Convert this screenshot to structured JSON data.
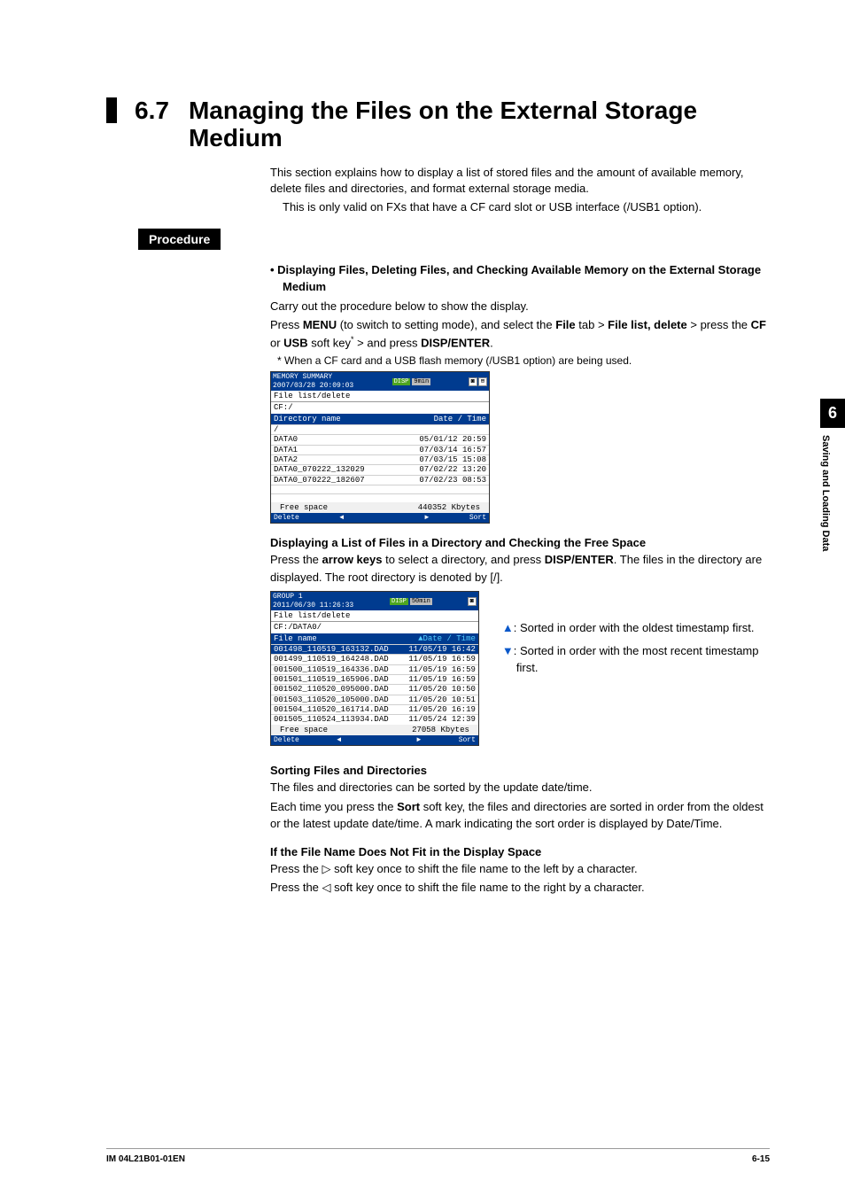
{
  "section": {
    "number": "6.7",
    "title": "Managing the Files on the External Storage Medium"
  },
  "intro": {
    "p1": "This section explains how to display a list of stored files and the amount of available memory, delete files and directories, and format external storage media.",
    "p2": "This is only valid on FXs that have a CF card slot or USB interface (/USB1 option)."
  },
  "procedure_label": "Procedure",
  "step1": {
    "heading": "Displaying Files, Deleting Files, and Checking Available Memory on the External Storage Medium",
    "p1": "Carry out the procedure below to show the display.",
    "p2a": "Press ",
    "p2_menu": "MENU",
    "p2b": " (to switch to setting mode), and select the ",
    "p2_file": "File",
    "p2c": " tab > ",
    "p2_fld": "File list, delete",
    "p2d": " > press the ",
    "p2_cf": "CF",
    "p2e": " or ",
    "p2_usb": "USB",
    "p2f": " soft key",
    "p2_sup": "*",
    "p2g": " > and press ",
    "p2_de": "DISP/ENTER",
    "p2h": ".",
    "footnote": "When a CF card and a USB flash memory (/USB1 option) are being used."
  },
  "ss1": {
    "title_line1": "MEMORY SUMMARY",
    "title_line2": "2007/03/28 20:09:03",
    "badge_disp": "DISP",
    "badge_time": "9min",
    "subbar": "File list/delete",
    "path": "CF:/",
    "hdr_l": "Directory name",
    "hdr_r": "Date / Time",
    "rows": [
      {
        "l": "/",
        "r": ""
      },
      {
        "l": "DATA0",
        "r": "05/01/12 20:59"
      },
      {
        "l": "DATA1",
        "r": "07/03/14 16:57"
      },
      {
        "l": "DATA2",
        "r": "07/03/15 15:08"
      },
      {
        "l": "DATA0_070222_132029",
        "r": "07/02/22 13:20"
      },
      {
        "l": "DATA0_070222_182607",
        "r": "07/02/23 08:53"
      }
    ],
    "free_l": "Free space",
    "free_r": "440352 Kbytes",
    "btm_delete": "Delete",
    "btm_sort": "Sort",
    "btm_l": "◄",
    "btm_rarr": "►"
  },
  "step2": {
    "heading": "Displaying a List of Files in a Directory and Checking the Free Space",
    "p1a": "Press the ",
    "p1_ak": "arrow keys",
    "p1b": " to select a directory, and press ",
    "p1_de": "DISP/ENTER",
    "p1c": ". The files in the directory are displayed. The root directory is denoted by [/]."
  },
  "ss2": {
    "title_line1": "GROUP 1",
    "title_line2": "2011/06/30 11:26:33",
    "badge_disp": "DISP",
    "badge_time": "50min",
    "subbar": "File list/delete",
    "path": "CF:/DATA0/",
    "hdr_l": "File name",
    "hdr_r": "▲Date / Time",
    "rows": [
      {
        "l": "001498_110519_163132.DAD",
        "r": "11/05/19 16:42",
        "sel": true
      },
      {
        "l": "001499_110519_164248.DAD",
        "r": "11/05/19 16:59"
      },
      {
        "l": "001500_110519_164336.DAD",
        "r": "11/05/19 16:59"
      },
      {
        "l": "001501_110519_165906.DAD",
        "r": "11/05/19 16:59"
      },
      {
        "l": "001502_110520_095000.DAD",
        "r": "11/05/20 10:50"
      },
      {
        "l": "001503_110520_105000.DAD",
        "r": "11/05/20 10:51"
      },
      {
        "l": "001504_110520_161714.DAD",
        "r": "11/05/20 16:19"
      },
      {
        "l": "001505_110524_113934.DAD",
        "r": "11/05/24 12:39"
      }
    ],
    "free_l": "Free space",
    "free_r": "27058 Kbytes",
    "btm_delete": "Delete",
    "btm_sort": "Sort",
    "btm_l": "◄",
    "btm_rarr": "►"
  },
  "legend": {
    "up": "▲",
    "up_text": ": Sorted in order with the oldest timestamp first.",
    "down": "▼",
    "down_text": ": Sorted in order with the most recent timestamp first."
  },
  "sorting": {
    "heading": "Sorting Files and Directories",
    "p1": "The files and directories can be sorted by the update date/time.",
    "p2a": "Each time you press the ",
    "p2_sort": "Sort",
    "p2b": " soft key, the files and directories are sorted in order from the oldest or the latest update date/time. A mark indicating the sort order is displayed by Date/Time."
  },
  "filename_fit": {
    "heading": "If the File Name Does Not Fit in the Display Space",
    "p1a": "Press the ",
    "p1_r": "▷",
    "p1b": " soft key once to shift the file name to the left by a character.",
    "p2a": "Press the ",
    "p2_l": "◁",
    "p2b": " soft key once to shift the file name to the right by a character."
  },
  "sidetab": {
    "num": "6",
    "text": "Saving and Loading Data"
  },
  "footer": {
    "left": "IM 04L21B01-01EN",
    "right": "6-15"
  }
}
